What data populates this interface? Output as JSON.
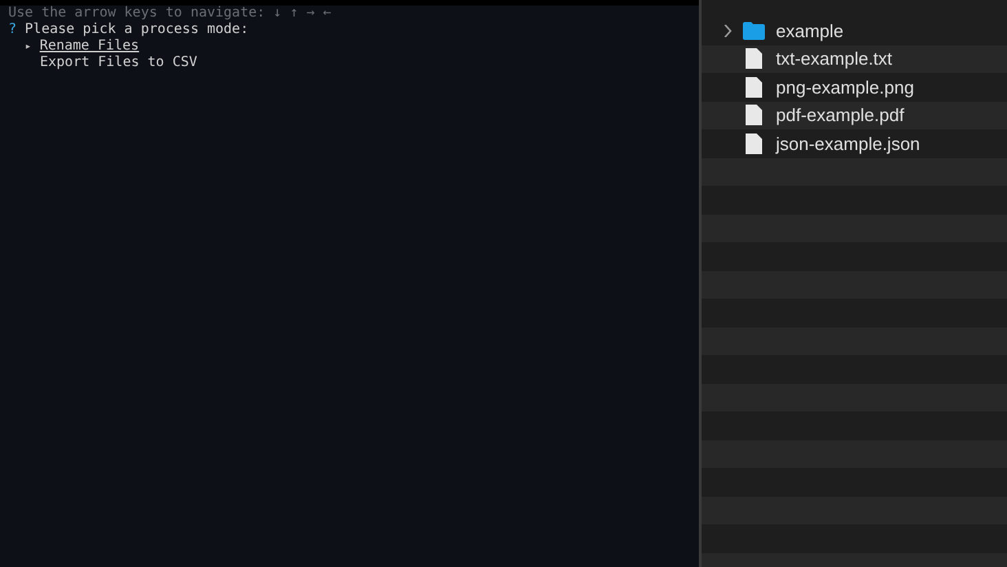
{
  "terminal": {
    "hint": "Use the arrow keys to navigate: ↓ ↑ → ←",
    "prompt_mark": "?",
    "question": "Please pick a process mode:",
    "options": [
      {
        "pointer": "▸",
        "label": "Rename Files",
        "selected": true
      },
      {
        "label": "Export Files to CSV",
        "selected": false
      }
    ]
  },
  "finder": {
    "items": [
      {
        "kind": "folder",
        "name": "example",
        "expanded": false
      },
      {
        "kind": "file",
        "name": "txt-example.txt"
      },
      {
        "kind": "file",
        "name": "png-example.png"
      },
      {
        "kind": "file",
        "name": "pdf-example.pdf"
      },
      {
        "kind": "file",
        "name": "json-example.json"
      }
    ]
  }
}
